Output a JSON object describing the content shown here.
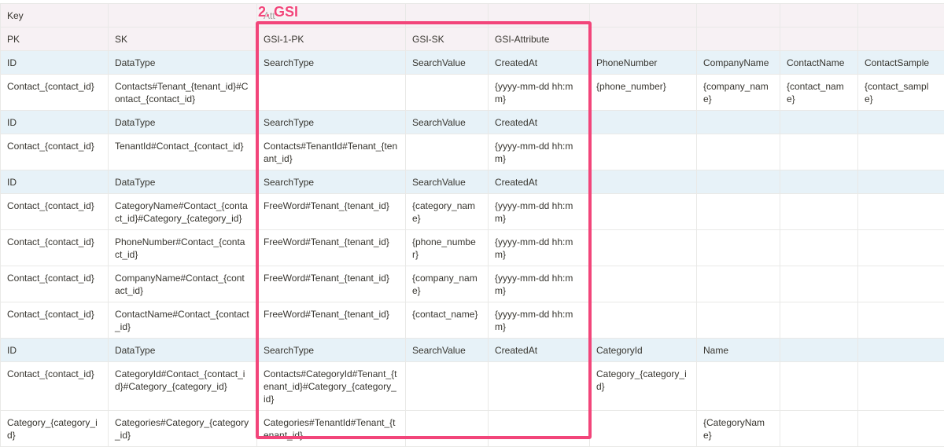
{
  "annotation": {
    "label": "2. GSI",
    "color": "#f2457a"
  },
  "key_row": {
    "key": "Key",
    "obscured": "Att"
  },
  "header": [
    "PK",
    "SK",
    "GSI-1-PK",
    "GSI-SK",
    "GSI-Attribute",
    "",
    "",
    "",
    ""
  ],
  "rows": [
    {
      "kind": "type",
      "cells": [
        "ID",
        "DataType",
        "SearchType",
        "SearchValue",
        "CreatedAt",
        "PhoneNumber",
        "CompanyName",
        "ContactName",
        "ContactSample"
      ]
    },
    {
      "kind": "data",
      "cells": [
        "Contact_{contact_id}",
        "Contacts#Tenant_{tenant_id}#Contact_{contact_id}",
        "",
        "",
        "{yyyy-mm-dd hh:mm}",
        "{phone_number}",
        "{company_name}",
        "{contact_name}",
        "{contact_sample}"
      ]
    },
    {
      "kind": "type",
      "cells": [
        "ID",
        "DataType",
        "SearchType",
        "SearchValue",
        "CreatedAt",
        "",
        "",
        "",
        ""
      ]
    },
    {
      "kind": "data",
      "cells": [
        "Contact_{contact_id}",
        "TenantId#Contact_{contact_id}",
        "Contacts#TenantId#Tenant_{tenant_id}",
        "",
        "{yyyy-mm-dd hh:mm}",
        "",
        "",
        "",
        ""
      ]
    },
    {
      "kind": "type",
      "cells": [
        "ID",
        "DataType",
        "SearchType",
        "SearchValue",
        "CreatedAt",
        "",
        "",
        "",
        ""
      ]
    },
    {
      "kind": "data",
      "cells": [
        "Contact_{contact_id}",
        "CategoryName#Contact_{contact_id}#Category_{category_id}",
        "FreeWord#Tenant_{tenant_id}",
        "{category_name}",
        "{yyyy-mm-dd hh:mm}",
        "",
        "",
        "",
        ""
      ]
    },
    {
      "kind": "data",
      "cells": [
        "Contact_{contact_id}",
        "PhoneNumber#Contact_{contact_id}",
        "FreeWord#Tenant_{tenant_id}",
        "{phone_number}",
        "{yyyy-mm-dd hh:mm}",
        "",
        "",
        "",
        ""
      ]
    },
    {
      "kind": "data",
      "cells": [
        "Contact_{contact_id}",
        "CompanyName#Contact_{contact_id}",
        "FreeWord#Tenant_{tenant_id}",
        "{company_name}",
        "{yyyy-mm-dd hh:mm}",
        "",
        "",
        "",
        ""
      ]
    },
    {
      "kind": "data",
      "cells": [
        "Contact_{contact_id}",
        "ContactName#Contact_{contact_id}",
        "FreeWord#Tenant_{tenant_id}",
        "{contact_name}",
        "{yyyy-mm-dd hh:mm}",
        "",
        "",
        "",
        ""
      ]
    },
    {
      "kind": "type",
      "cells": [
        "ID",
        "DataType",
        "SearchType",
        "SearchValue",
        "CreatedAt",
        "CategoryId",
        "Name",
        "",
        ""
      ]
    },
    {
      "kind": "data",
      "cells": [
        "Contact_{contact_id}",
        "CategoryId#Contact_{contact_id}#Category_{category_id}",
        "Contacts#CategoryId#Tenant_{tenant_id}#Category_{category_id}",
        "",
        "",
        "Category_{category_id}",
        "",
        "",
        ""
      ]
    },
    {
      "kind": "data",
      "cells": [
        "Category_{category_id}",
        "Categories#Category_{category_id}",
        "Categories#TenantId#Tenant_{tenant_id}",
        "",
        "",
        "",
        "{CategoryName}",
        "",
        ""
      ]
    }
  ]
}
